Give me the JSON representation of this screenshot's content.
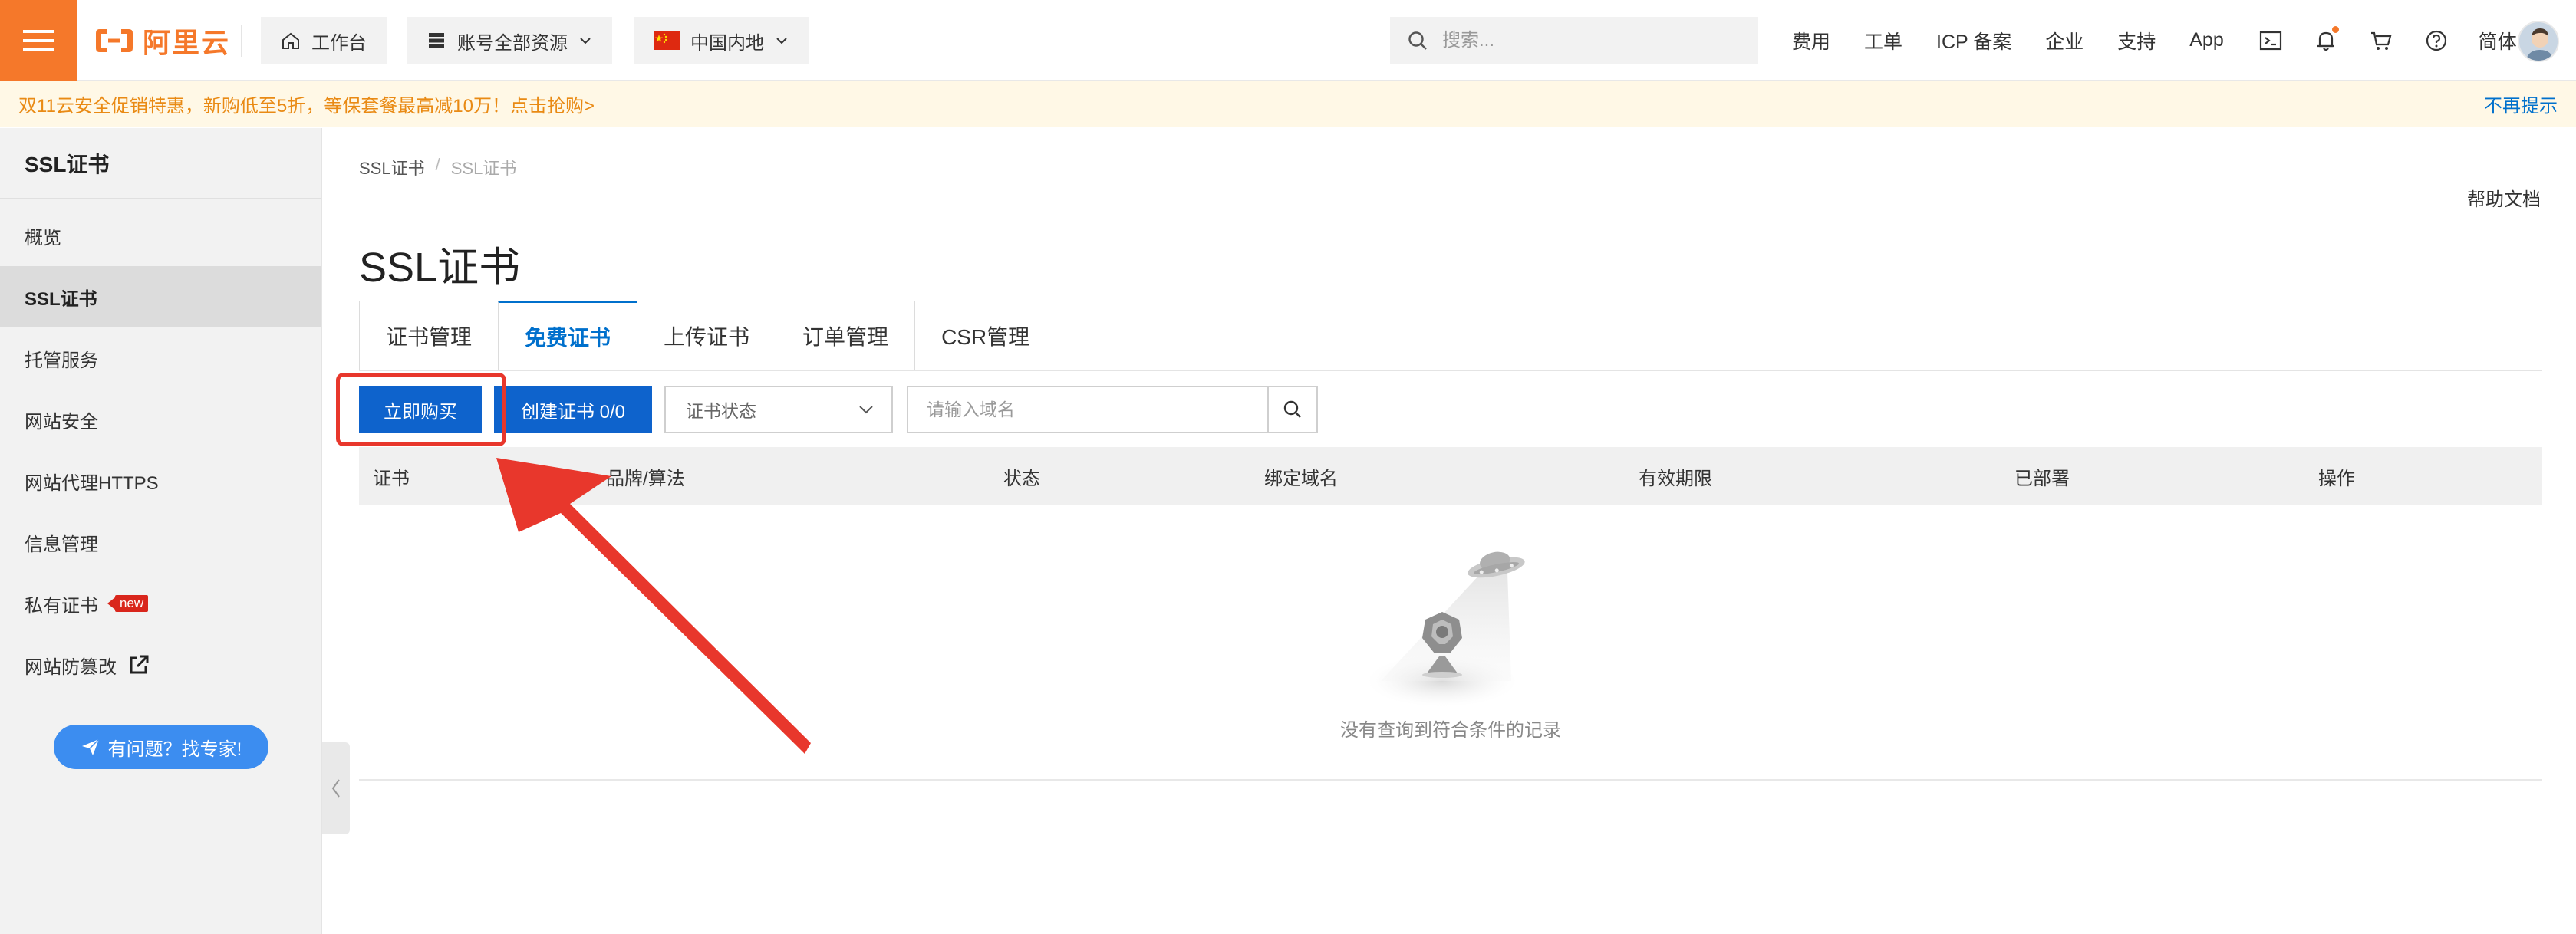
{
  "header": {
    "logo_text": "阿里云",
    "workbench_label": "工作台",
    "resources_label": "账号全部资源",
    "region_label": "中国内地",
    "search_placeholder": "搜索...",
    "links": [
      "费用",
      "工单",
      "ICP 备案",
      "企业",
      "支持",
      "App"
    ],
    "lang_label": "简体",
    "icons": [
      "terminal-icon",
      "bell-icon",
      "cart-icon",
      "help-icon"
    ]
  },
  "notice": {
    "text": "双11云安全促销特惠，新购低至5折，等保套餐最高减10万！点击抢购>",
    "close_label": "不再提示"
  },
  "sidebar": {
    "title": "SSL证书",
    "items": [
      {
        "label": "概览"
      },
      {
        "label": "SSL证书"
      },
      {
        "label": "托管服务"
      },
      {
        "label": "网站安全"
      },
      {
        "label": "网站代理HTTPS"
      },
      {
        "label": "信息管理"
      },
      {
        "label": "私有证书"
      },
      {
        "label": "网站防篡改"
      }
    ],
    "new_badge": "new",
    "expert_label": "有问题？找专家!"
  },
  "breadcrumb": {
    "root": "SSL证书",
    "separator": "/",
    "current": "SSL证书"
  },
  "page": {
    "title": "SSL证书",
    "help_label": "帮助文档"
  },
  "tabs": [
    {
      "label": "证书管理"
    },
    {
      "label": "免费证书"
    },
    {
      "label": "上传证书"
    },
    {
      "label": "订单管理"
    },
    {
      "label": "CSR管理"
    }
  ],
  "toolbar": {
    "buy_label": "立即购买",
    "create_label": "创建证书 0/0",
    "status_select": "证书状态",
    "domain_placeholder": "请输入域名"
  },
  "table": {
    "columns": [
      "证书",
      "品牌/算法",
      "状态",
      "绑定域名",
      "有效期限",
      "已部署",
      "操作"
    ],
    "rows": [],
    "empty_text": "没有查询到符合条件的记录"
  },
  "colors": {
    "brand_orange": "#f5782a",
    "primary_blue": "#0e63cc",
    "annotation_red": "#e8372c",
    "notice_text": "#e98a14"
  }
}
